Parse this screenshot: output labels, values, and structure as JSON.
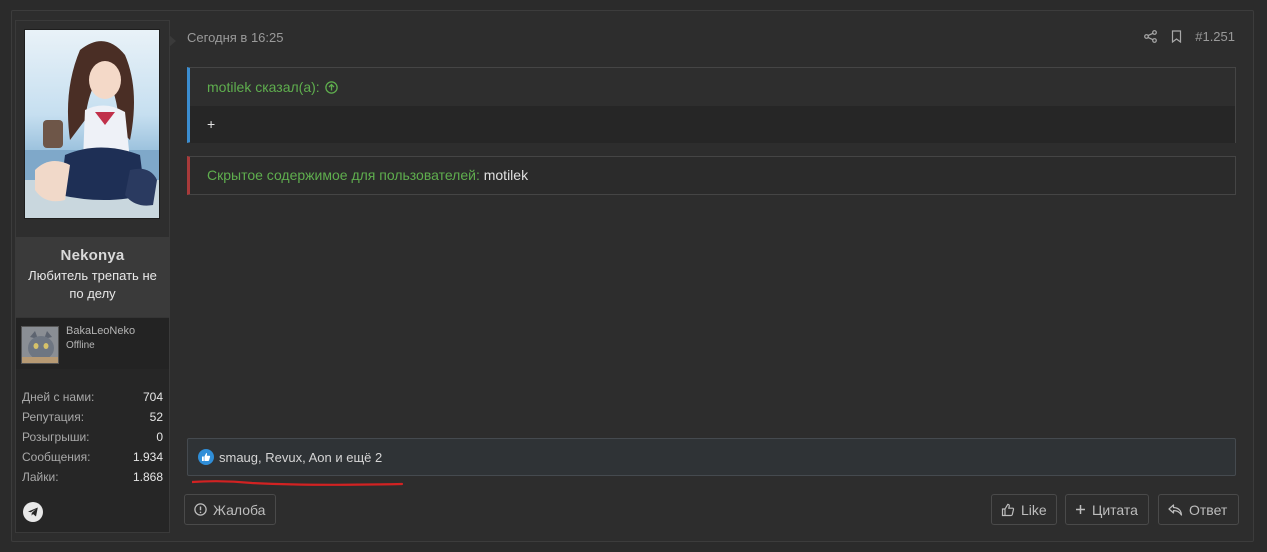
{
  "user": {
    "name": "Nekonya",
    "title": "Любитель трепать не по делу",
    "linked_account": {
      "name": "BakaLeoNeko",
      "status": "Offline"
    },
    "stats": [
      {
        "label": "Дней с нами:",
        "value": "704"
      },
      {
        "label": "Репутация:",
        "value": "52"
      },
      {
        "label": "Розыгрыши:",
        "value": "0"
      },
      {
        "label": "Сообщения:",
        "value": "1.934"
      },
      {
        "label": "Лайки:",
        "value": "1.868"
      }
    ],
    "contact_icon": "telegram-icon"
  },
  "post": {
    "date": "Сегодня в 16:25",
    "number": "#1.251",
    "quote": {
      "author_line": "motilek сказал(а):",
      "text": "+"
    },
    "hidden": {
      "label": "Скрытое содержимое для пользователей:",
      "user": "motilek"
    },
    "reactions_text": "smaug, Revux, Aon и ещё 2"
  },
  "actions": {
    "report": "Жалоба",
    "like": "Like",
    "quote": "Цитата",
    "reply": "Ответ"
  },
  "colors": {
    "accent_green": "#5fae4e",
    "quote_border": "#3b8dd0",
    "hidden_border": "#a83a3a",
    "like_blue": "#2f8ed8",
    "annotation_red": "#d22222"
  }
}
